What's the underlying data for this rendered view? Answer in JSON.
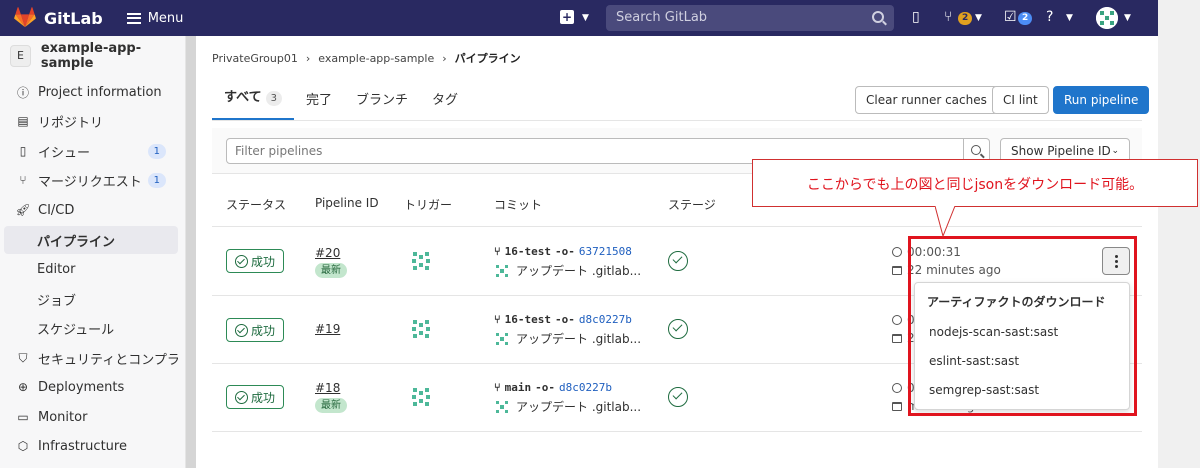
{
  "topbar": {
    "brand": "GitLab",
    "menu_label": "Menu",
    "search_placeholder": "Search GitLab",
    "mr_count": "2",
    "todo_count": "2"
  },
  "sidebar": {
    "project_initial": "E",
    "project_name": "example-app-sample",
    "items": [
      {
        "label": "Project information",
        "icon": "info-icon"
      },
      {
        "label": "リポジトリ",
        "icon": "document-icon"
      },
      {
        "label": "イシュー",
        "icon": "issues-icon",
        "badge": "1"
      },
      {
        "label": "マージリクエスト",
        "icon": "merge-request-icon",
        "badge": "1"
      },
      {
        "label": "CI/CD",
        "icon": "rocket-icon"
      },
      {
        "label": "パイプライン"
      },
      {
        "label": "Editor"
      },
      {
        "label": "ジョブ"
      },
      {
        "label": "スケジュール"
      },
      {
        "label": "セキュリティとコンプライ",
        "icon": "shield-icon"
      },
      {
        "label": "Deployments",
        "icon": "deployments-icon"
      },
      {
        "label": "Monitor",
        "icon": "monitor-icon"
      },
      {
        "label": "Infrastructure",
        "icon": "infrastructure-icon"
      }
    ]
  },
  "breadcrumb": [
    "PrivateGroup01",
    "example-app-sample",
    "パイプライン"
  ],
  "tabs": [
    {
      "label": "すべて",
      "count": "3"
    },
    {
      "label": "完了"
    },
    {
      "label": "ブランチ"
    },
    {
      "label": "タグ"
    }
  ],
  "buttons": {
    "clear_caches": "Clear runner caches",
    "ci_lint": "CI lint",
    "run_pipeline": "Run pipeline"
  },
  "filter": {
    "placeholder": "Filter pipelines",
    "sort_label": "Show Pipeline ID"
  },
  "table": {
    "headers": [
      "ステータス",
      "Pipeline ID",
      "トリガー",
      "コミット",
      "ステージ"
    ],
    "rows": [
      {
        "status": "成功",
        "id": "#20",
        "latest": "最新",
        "branch": "16-test",
        "sha": "63721508",
        "message": "アップデート .gitlab...",
        "duration": "00:00:31",
        "finished": "22 minutes ago"
      },
      {
        "status": "成功",
        "id": "#19",
        "latest": "",
        "branch": "16-test",
        "sha": "d8c0227b",
        "message": "アップデート .gitlab...",
        "duration": "0",
        "finished": "2"
      },
      {
        "status": "成功",
        "id": "#18",
        "latest": "最新",
        "branch": "main",
        "sha": "d8c0227b",
        "message": "アップデート .gitlab...",
        "duration": "0",
        "finished": "minutes ago"
      }
    ]
  },
  "dropdown": {
    "header": "アーティファクトのダウンロード",
    "items": [
      "nodejs-scan-sast:sast",
      "eslint-sast:sast",
      "semgrep-sast:sast"
    ]
  },
  "callout": {
    "text": "ここからでも上の図と同じjsonをダウンロード可能。"
  }
}
